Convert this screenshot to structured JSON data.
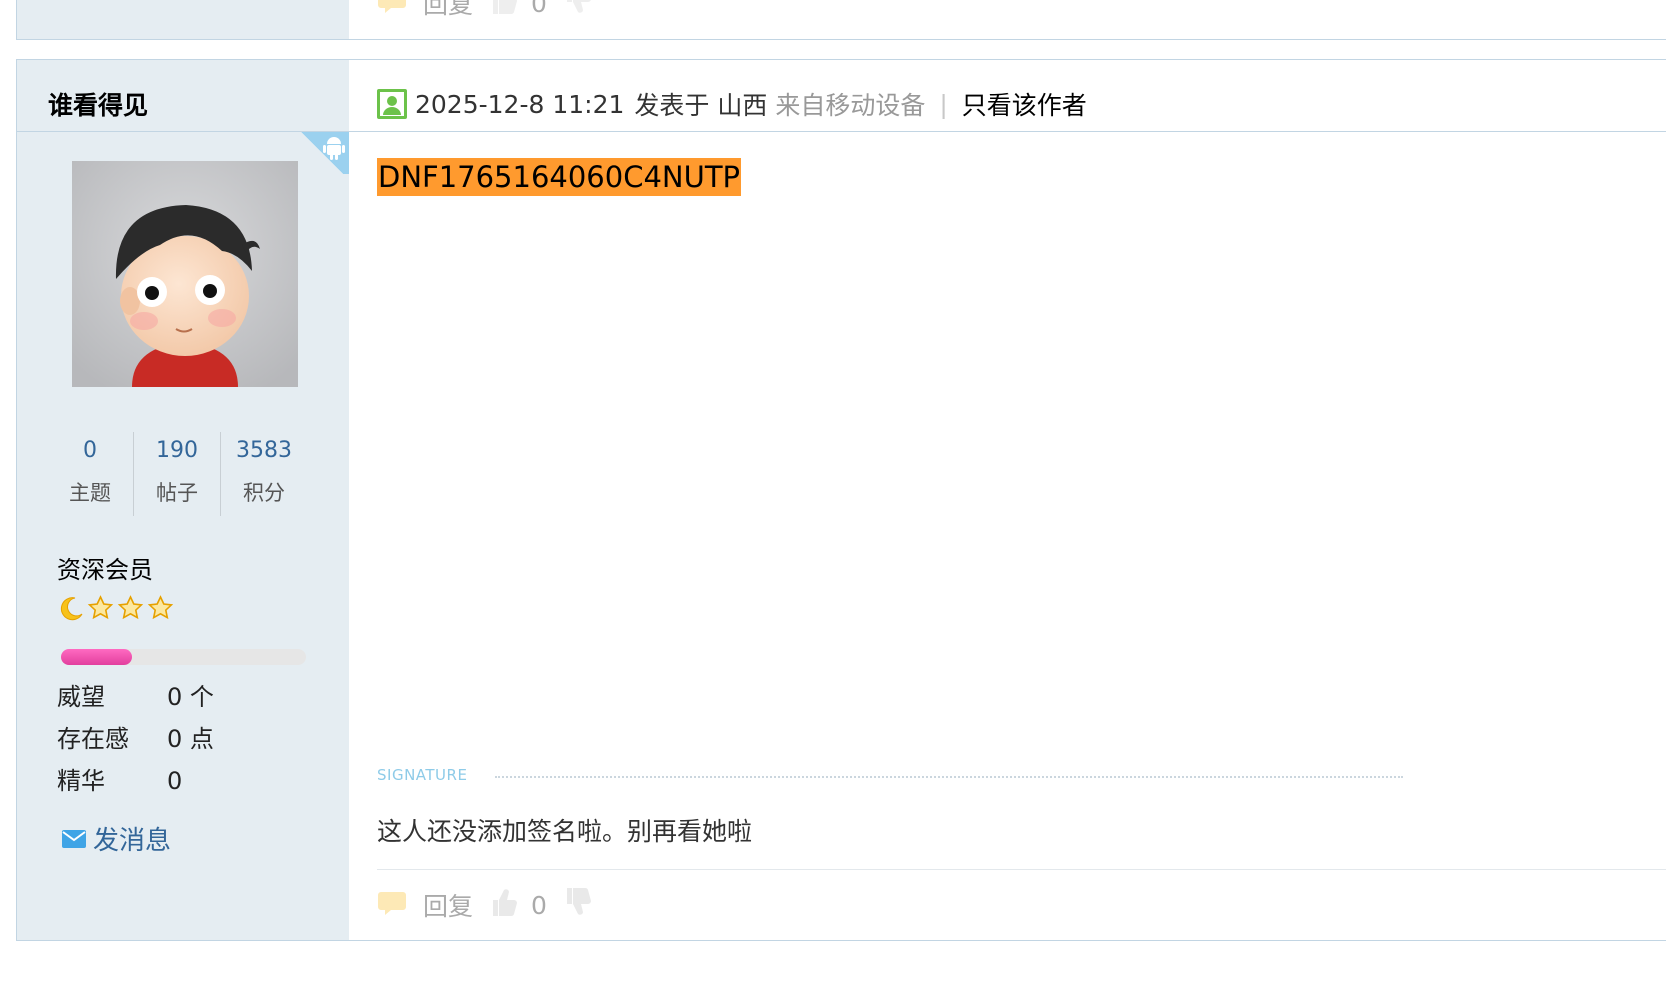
{
  "prev_post": {
    "reply_label": "回复",
    "like_count": "0"
  },
  "author": {
    "name": "谁看得见",
    "stats": [
      {
        "value": "0",
        "label": "主题"
      },
      {
        "value": "190",
        "label": "帖子"
      },
      {
        "value": "3583",
        "label": "积分"
      }
    ],
    "group": "资深会员",
    "level_icons": [
      "moon-icon",
      "star-icon",
      "star-icon",
      "star-icon"
    ],
    "exp_progress": 0.29,
    "info": [
      {
        "key": "威望",
        "value": "0 个"
      },
      {
        "key": "存在感",
        "value": "0 点"
      },
      {
        "key": "精华",
        "value": "0"
      }
    ],
    "send_message": "发消息"
  },
  "post": {
    "date": "2025-12-8 11:21",
    "posted_at": "发表于 山西",
    "from_device": "来自移动设备",
    "separator": "|",
    "only_author": "只看该作者",
    "content": "DNF1765164060C4NUTP",
    "signature_label": "SIGNATURE",
    "signature": "这人还没添加签名啦。别再看她啦",
    "reply_label": "回复",
    "like_count": "0"
  },
  "colors": {
    "sidebar_bg": "#e5edf2",
    "border": "#c2d5e3",
    "highlight": "#ff9a2e",
    "link": "#336699",
    "exp_bar": "#e23f9e"
  }
}
